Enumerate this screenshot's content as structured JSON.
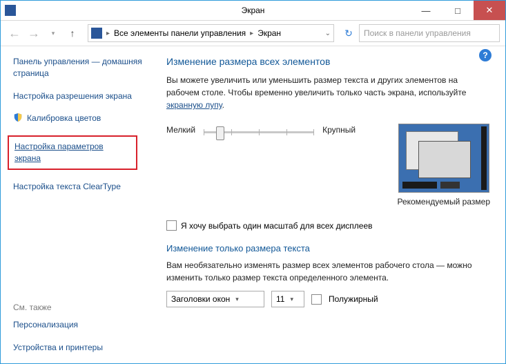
{
  "window": {
    "title": "Экран",
    "minimize": "—",
    "maximize": "□",
    "close": "✕"
  },
  "nav": {
    "breadcrumb1": "Все элементы панели управления",
    "breadcrumb2": "Экран",
    "search_placeholder": "Поиск в панели управления"
  },
  "sidebar": {
    "home": "Панель управления — домашняя страница",
    "resolution": "Настройка разрешения экрана",
    "calibration": "Калибровка цветов",
    "params": "Настройка параметров экрана",
    "cleartype": "Настройка текста ClearType",
    "see_also_title": "См. также",
    "personalization": "Персонализация",
    "devices": "Устройства и принтеры"
  },
  "main": {
    "heading1": "Изменение размера всех элементов",
    "desc_part1": "Вы можете увеличить или уменьшить размер текста и других элементов на рабочем столе. Чтобы временно увеличить только часть экрана, используйте ",
    "desc_link": "экранную лупу",
    "slider_small": "Мелкий",
    "slider_large": "Крупный",
    "recommended": "Рекомендуемый размер",
    "checkbox_label": "Я хочу выбрать один масштаб для всех дисплеев",
    "heading2": "Изменение только размера текста",
    "desc2": "Вам необязательно изменять размер всех элементов рабочего стола — можно изменить только размер текста определенного элемента.",
    "dropdown_element": "Заголовки окон",
    "dropdown_size": "11",
    "bold_label": "Полужирный"
  }
}
